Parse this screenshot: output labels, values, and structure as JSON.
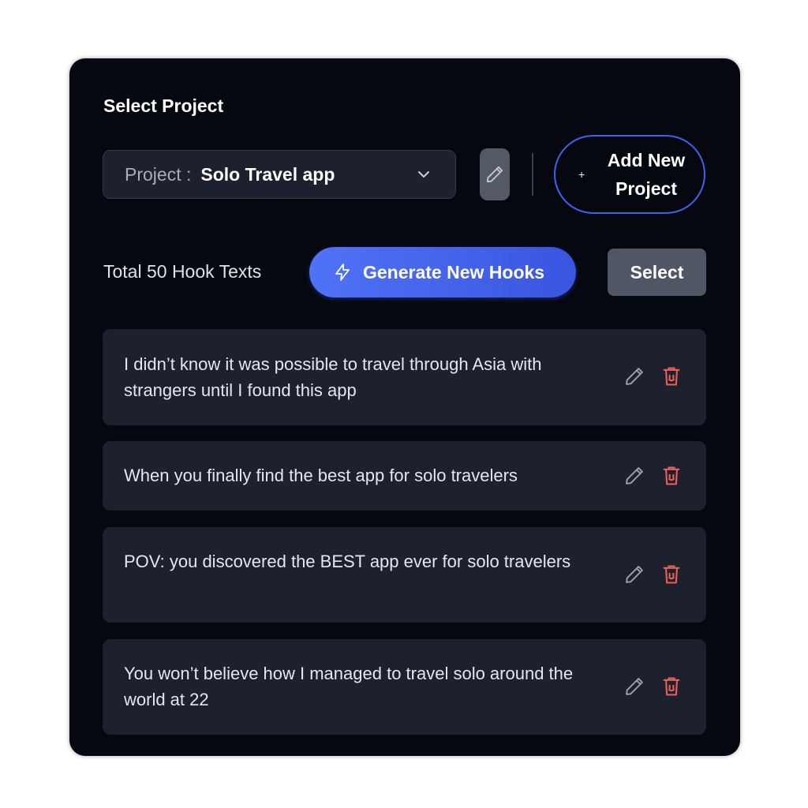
{
  "project_selector": {
    "section_title": "Select Project",
    "prefix": "Project :",
    "selected_project": "Solo Travel app",
    "add_button_label": "Add New Project",
    "add_button_icon": "plus-icon",
    "edit_icon": "pencil-icon",
    "dropdown_icon": "chevron-down-icon"
  },
  "toolbar": {
    "count_text": "Total 50 Hook Texts",
    "generate_label": "Generate New Hooks",
    "generate_icon": "lightning-icon",
    "select_label": "Select"
  },
  "hooks": [
    {
      "text": "I didn’t know it was possible to travel through Asia with strangers until I found this app"
    },
    {
      "text": "When you finally find the best app for solo travelers"
    },
    {
      "text": "POV: you discovered the BEST app ever for solo travelers"
    },
    {
      "text": "You won’t believe how I managed to travel solo around the world at 22"
    }
  ],
  "colors": {
    "panel_bg": "#060810",
    "card_bg": "#1c212d",
    "accent": "#3a63f2",
    "delete": "#e8605a",
    "secondary_button": "#505764"
  }
}
